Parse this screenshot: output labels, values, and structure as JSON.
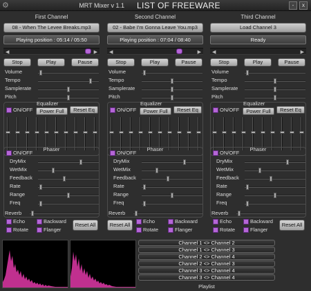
{
  "window": {
    "title": "MRT Mixer v 1.1",
    "banner": "LIST OF FREEWARE",
    "minimize_glyph": "-",
    "close_glyph": "x"
  },
  "labels": {
    "stop": "Stop",
    "play": "Play",
    "pause": "Pause",
    "volume": "Volume",
    "tempo": "Tempo",
    "samplerate": "Samplerate",
    "pitch": "Pitch",
    "equalizer": "Equalizer",
    "onoff": "ON/OFF",
    "power_full": "Power Full",
    "reset_eq": "Reset Eq",
    "phaser": "Phaser",
    "drymix": "DryMix",
    "wetmix": "WetMix",
    "feedback": "Feedback",
    "rate": "Rate",
    "range": "Range",
    "freq": "Freq",
    "reverb": "Reverb",
    "echo": "Echo",
    "backward": "Backward",
    "rotate": "Rotate",
    "flanger": "Flanger",
    "reset_all": "Reset All",
    "seek_left": "◀",
    "seek_right": "▶"
  },
  "channels": [
    {
      "title": "First Channel",
      "file": "08 - When The Levee Breaks.mp3",
      "status": "Playing position : 05:14 / 05:50",
      "seek_fraction": 0.88
    },
    {
      "title": "Second Channel",
      "file": "02 - Babe I'm Gonna Leave You.mp3",
      "status": "Playing position : 07:04 / 08:40",
      "seek_fraction": 0.79
    },
    {
      "title": "Third Channel",
      "file": "Load Channel 3",
      "status": "Ready",
      "seek_fraction": 0.0
    }
  ],
  "playlist": {
    "title": "Playlist",
    "items": [
      "Channel 1 <> Channel 2",
      "Channel 1 <> Channel 3",
      "Channel 2 <> Channel 4",
      "Channel 2 <> Channel 3",
      "Channel 3 <> Channel 4",
      "Channel 3 <> Channel 4"
    ]
  },
  "colors": {
    "accent": "#b566d6",
    "background": "#2e2e2e",
    "visualizer": "#c0308f"
  }
}
